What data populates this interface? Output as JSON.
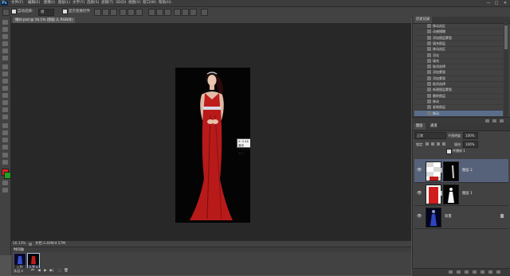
{
  "app": {
    "logo": "Ps"
  },
  "menu": [
    "文件(F)",
    "编辑(E)",
    "图像(I)",
    "图层(L)",
    "文字(Y)",
    "选择(S)",
    "滤镜(T)",
    "3D(D)",
    "视图(V)",
    "窗口(W)",
    "帮助(H)"
  ],
  "window_controls": [
    "—",
    "□",
    "✕"
  ],
  "options": {
    "auto_select_label": "自动选择：",
    "auto_select_value": "组",
    "show_transform_label": "显示变换控件"
  },
  "document": {
    "tab_label": "婚纱.psd @ 16.1% (图层 2, RGB/8)",
    "tooltip_line1": "X: 5.46 厘米",
    "tooltip_line2": "Y: 16.45 厘米"
  },
  "status": {
    "zoom": "16.13%",
    "doc_info": "文档:3.40M/4.57M"
  },
  "animation": {
    "panel_title": "时间轴",
    "frames": [
      {
        "label": "0 秒"
      },
      {
        "label": "0 秒 ▾"
      }
    ],
    "loop_label": "永远 ▾",
    "controls": [
      "⏮",
      "◀",
      "▶",
      "▶|",
      "⬚",
      "🗑"
    ]
  },
  "history": {
    "tab_label": "历史记录",
    "items": [
      {
        "label": "移动选区"
      },
      {
        "label": "动感模糊"
      },
      {
        "label": "添加图层蒙版"
      },
      {
        "label": "填充图层"
      },
      {
        "label": "移动选区"
      },
      {
        "label": "羽化"
      },
      {
        "label": "填充"
      },
      {
        "label": "取消选择"
      },
      {
        "label": "添加蒙版"
      },
      {
        "label": "添加蒙版"
      },
      {
        "label": "取消选择"
      },
      {
        "label": "新建图层蒙版"
      },
      {
        "label": "删除图层"
      },
      {
        "label": "移动"
      },
      {
        "label": "复制图层"
      },
      {
        "label": "移动"
      }
    ]
  },
  "layers": {
    "tabs": [
      "图层",
      "通道"
    ],
    "blend_mode": "正常",
    "opacity_label": "不透明度:",
    "opacity_value": "100%",
    "lock_label": "锁定:",
    "fill_label": "填充:",
    "fill_value": "100%",
    "unify_label": "传播帧 1",
    "items": [
      {
        "name": "图层 2",
        "selected": true
      },
      {
        "name": "图层 1",
        "selected": false
      },
      {
        "name": "背景",
        "selected": false
      }
    ]
  },
  "colors": {
    "accent": "#5a6e8c",
    "dress_red": "#c01d1d",
    "foreground_swatch": "#e02020",
    "background_swatch": "#20a020"
  }
}
